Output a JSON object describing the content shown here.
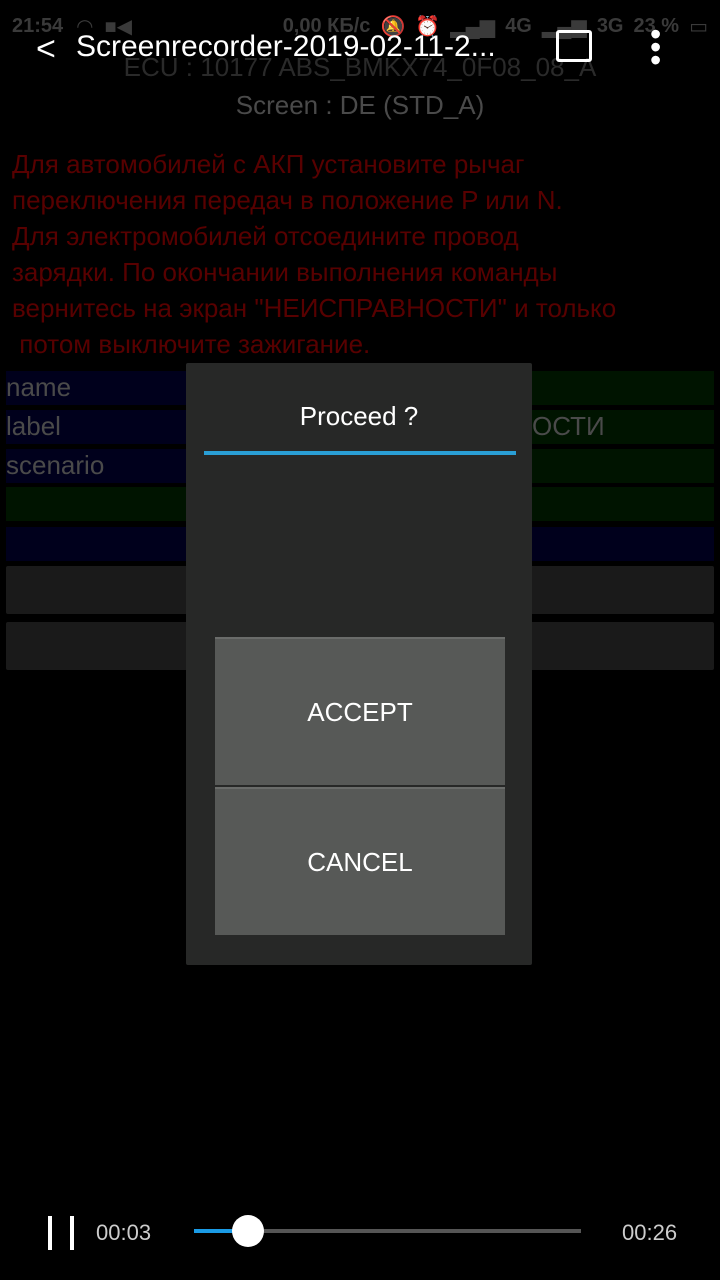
{
  "status_bar": {
    "time": "21:54",
    "net_speed": "0,00 КБ/с",
    "signal1": "4G",
    "signal2": "3G",
    "battery": "23 %"
  },
  "app_bar": {
    "title": "Screenrecorder-2019-02-11-2...",
    "icons": [
      "back-icon",
      "cast-icon",
      "more-vert-icon"
    ]
  },
  "background": {
    "ecu": "ECU : 10177  ABS_BMKX74_0F08_08_A",
    "screen": "Screen : DE (STD_A)",
    "warning": "Для автомобилей с АКП установите рычаг\nпереключения передач в положение P или N.\nДля электромобилей отсоедините провод\nзарядки. По окончании выполнения команды\nвернитесь на экран \"НЕИСПРАВНОСТИ\" и только\n потом выключите зажигание.",
    "rows": [
      {
        "label": "name",
        "value": ""
      },
      {
        "label": "label",
        "value": "ОСТИ"
      },
      {
        "label": "scenario",
        "value": ""
      }
    ]
  },
  "dialog": {
    "title": "Proceed ?",
    "accept": "ACCEPT",
    "cancel": "CANCEL",
    "accent": "#2a9fd6"
  },
  "player": {
    "current": "00:03",
    "duration": "00:26",
    "progress": 0.14,
    "state": "playing"
  }
}
